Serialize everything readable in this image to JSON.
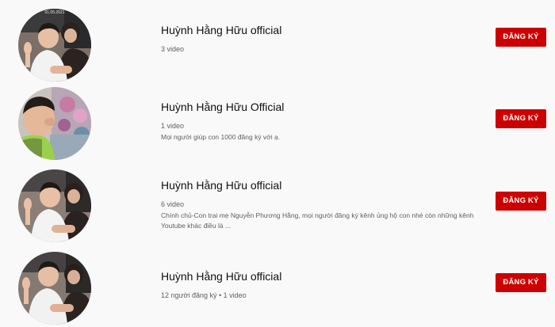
{
  "channels": [
    {
      "name": "Huỳnh Hằng Hữu official",
      "meta": "3 video",
      "description": "",
      "subscribe_label": "ĐĂNG KÝ",
      "avatar_stamp": "01.05.2021"
    },
    {
      "name": "Huỳnh Hằng Hữu Official",
      "meta": "1 video",
      "description": "Mọi người giúp con 1000 đăng ký với ạ.",
      "subscribe_label": "ĐĂNG KÝ",
      "avatar_stamp": ""
    },
    {
      "name": "Huỳnh Hằng Hữu official",
      "meta": "6 video",
      "description": "Chính chủ-Con trai mẹ Nguyễn Phương Hằng, mọi người đăng ký kênh ủng hộ con nhé còn những kênh Youtube khác điều là ...",
      "subscribe_label": "ĐĂNG KÝ",
      "avatar_stamp": ""
    },
    {
      "name": "Huỳnh Hằng Hữu official",
      "meta": "12 người đăng ký • 1 video",
      "description": "",
      "subscribe_label": "ĐĂNG KÝ",
      "avatar_stamp": ""
    }
  ]
}
